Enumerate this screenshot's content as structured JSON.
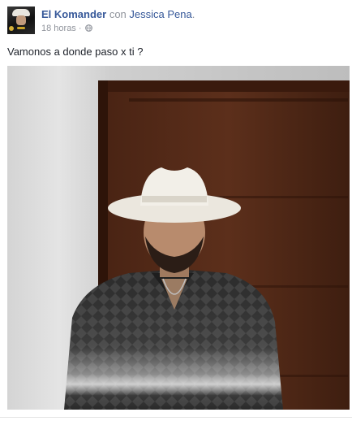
{
  "post": {
    "author_name": "El Komander",
    "with_text": "con",
    "tagged_name": "Jessica Pena",
    "tagged_suffix": ".",
    "timestamp": "18 horas",
    "separator": "·",
    "audience_icon": "globe-icon",
    "text": "Vamonos a donde paso x ti ?",
    "photo_subject": "man-in-white-cowboy-hat-photo"
  },
  "colors": {
    "link": "#365899",
    "muted": "#90949c",
    "text": "#1d2129"
  }
}
